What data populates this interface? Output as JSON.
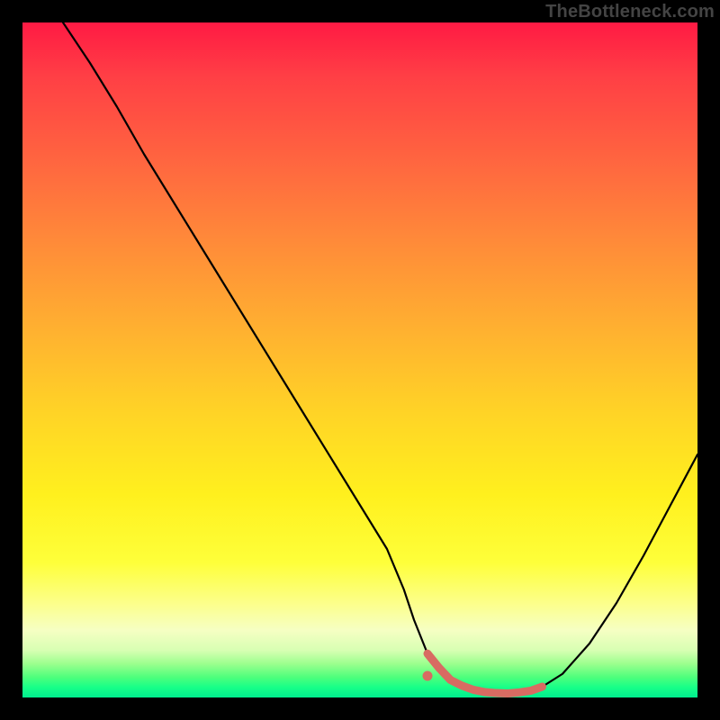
{
  "watermark": "TheBottleneck.com",
  "colors": {
    "curve": "#000000",
    "highlight": "#d86b62",
    "dot": "#d86b62"
  },
  "chart_data": {
    "type": "line",
    "title": "",
    "xlabel": "",
    "ylabel": "",
    "xlim": [
      0,
      100
    ],
    "ylim": [
      0,
      100
    ],
    "grid": false,
    "legend": false,
    "series": [
      {
        "name": "bottleneck-curve",
        "x": [
          6,
          10,
          14,
          18,
          22,
          26,
          30,
          34,
          38,
          42,
          46,
          50,
          54,
          56.5,
          58,
          60,
          63,
          66,
          69,
          72,
          75,
          77,
          80,
          84,
          88,
          92,
          96,
          100
        ],
        "y": [
          100,
          94,
          87.5,
          80.5,
          74,
          67.5,
          61,
          54.5,
          48,
          41.5,
          35,
          28.5,
          22,
          16,
          11.5,
          6.5,
          2.8,
          1.3,
          0.7,
          0.6,
          0.9,
          1.6,
          3.5,
          8,
          14,
          21,
          28.5,
          36
        ]
      }
    ],
    "highlight_segment": {
      "name": "optimal-range",
      "x_range": [
        60,
        77
      ],
      "y_approx": 1.0
    },
    "highlight_dot": {
      "x": 60,
      "y": 3.2
    }
  }
}
